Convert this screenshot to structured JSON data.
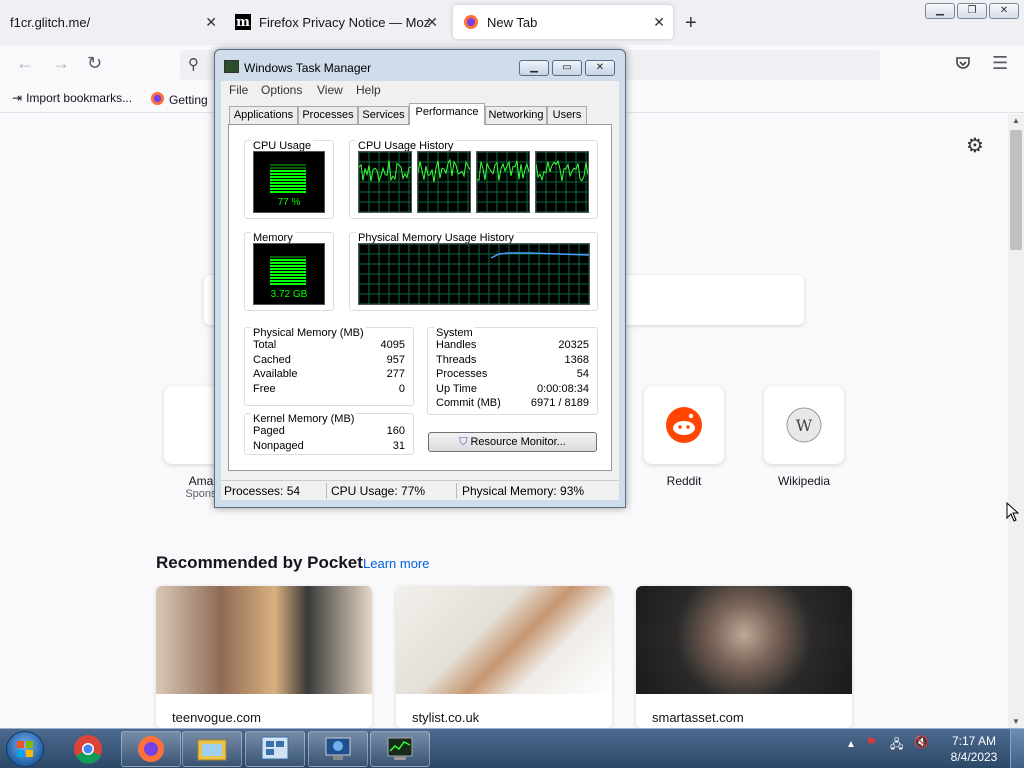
{
  "browser": {
    "tabs": [
      {
        "title": "f1cr.glitch.me/",
        "active": false
      },
      {
        "title": "Firefox Privacy Notice — Mozilla",
        "active": false
      },
      {
        "title": "New Tab",
        "active": true
      }
    ],
    "new_tab_symbol": "+",
    "window_controls": [
      "minimize",
      "restore",
      "close"
    ],
    "bookmarks": [
      "Import bookmarks...",
      "Getting"
    ],
    "colors": {
      "accent_link": "#0061e0",
      "firefox_orange": "#ff7139"
    }
  },
  "newtab": {
    "top_sites": [
      {
        "label": "Amazon",
        "sub": "Sponsored",
        "icon": "amazon-icon"
      },
      {
        "label": "Reddit",
        "sub": "",
        "icon": "reddit-icon"
      },
      {
        "label": "Wikipedia",
        "sub": "",
        "icon": "wikipedia-icon"
      }
    ],
    "top_sites_visible": [
      {
        "label": "Amaz",
        "sub": "Sponso"
      },
      {
        "label": "Reddit",
        "sub": ""
      },
      {
        "label": "Wikipedia",
        "sub": ""
      }
    ],
    "pocket_title": "Recommended by Pocket",
    "learn_more": "Learn more",
    "cards": [
      {
        "source": "teenvogue.com"
      },
      {
        "source": "stylist.co.uk"
      },
      {
        "source": "smartasset.com"
      }
    ]
  },
  "taskmanager": {
    "title": "Windows Task Manager",
    "menu": [
      "File",
      "Options",
      "View",
      "Help"
    ],
    "tabs": [
      "Applications",
      "Processes",
      "Services",
      "Performance",
      "Networking",
      "Users"
    ],
    "active_tab": "Performance",
    "cpu_usage_label": "CPU Usage",
    "cpu_usage_value": "77 %",
    "cpu_usage_fraction": 0.77,
    "cpu_history_label": "CPU Usage History",
    "memory_label": "Memory",
    "memory_value": "3.72 GB",
    "memory_fraction": 0.93,
    "phys_history_label": "Physical Memory Usage History",
    "physical_memory": {
      "caption": "Physical Memory (MB)",
      "rows": [
        {
          "k": "Total",
          "v": "4095"
        },
        {
          "k": "Cached",
          "v": "957"
        },
        {
          "k": "Available",
          "v": "277"
        },
        {
          "k": "Free",
          "v": "0"
        }
      ]
    },
    "kernel_memory": {
      "caption": "Kernel Memory (MB)",
      "rows": [
        {
          "k": "Paged",
          "v": "160"
        },
        {
          "k": "Nonpaged",
          "v": "31"
        }
      ]
    },
    "system": {
      "caption": "System",
      "rows": [
        {
          "k": "Handles",
          "v": "20325"
        },
        {
          "k": "Threads",
          "v": "1368"
        },
        {
          "k": "Processes",
          "v": "54"
        },
        {
          "k": "Up Time",
          "v": "0:00:08:34"
        },
        {
          "k": "Commit (MB)",
          "v": "6971 / 8189"
        }
      ]
    },
    "resource_monitor_button": "Resource Monitor...",
    "status": {
      "processes": "Processes: 54",
      "cpu": "CPU Usage: 77%",
      "memory": "Physical Memory: 93%"
    }
  },
  "taskbar": {
    "apps": [
      "chrome-icon",
      "firefox-icon",
      "explorer-icon",
      "control-panel-icon",
      "remote-desktop-icon",
      "task-manager-icon"
    ],
    "clock_time": "7:17 AM",
    "clock_date": "8/4/2023"
  }
}
